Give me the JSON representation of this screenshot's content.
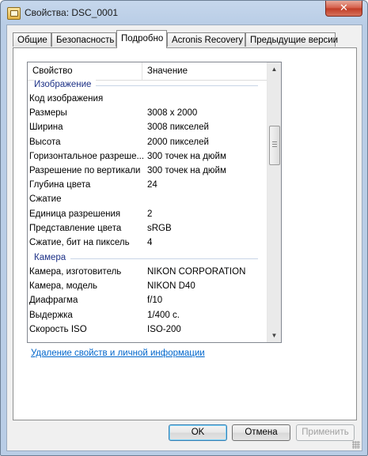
{
  "window": {
    "title": "Свойства: DSC_0001",
    "close_glyph": "✕"
  },
  "tabs": [
    {
      "label": "Общие"
    },
    {
      "label": "Безопасность"
    },
    {
      "label": "Подробно"
    },
    {
      "label": "Acronis Recovery"
    },
    {
      "label": "Предыдущие версии"
    }
  ],
  "list": {
    "columns": {
      "property": "Свойство",
      "value": "Значение"
    },
    "groups": [
      {
        "name": "Изображение",
        "rows": [
          {
            "k": "Код изображения",
            "v": ""
          },
          {
            "k": "Размеры",
            "v": "3008 x 2000"
          },
          {
            "k": "Ширина",
            "v": "3008 пикселей"
          },
          {
            "k": "Высота",
            "v": "2000 пикселей"
          },
          {
            "k": "Горизонтальное разреше...",
            "v": "300 точек на дюйм"
          },
          {
            "k": "Разрешение по вертикали",
            "v": "300 точек на дюйм"
          },
          {
            "k": "Глубина цвета",
            "v": "24"
          },
          {
            "k": "Сжатие",
            "v": ""
          },
          {
            "k": "Единица разрешения",
            "v": "2"
          },
          {
            "k": "Представление цвета",
            "v": "sRGB"
          },
          {
            "k": "Сжатие, бит на пиксель",
            "v": "4"
          }
        ]
      },
      {
        "name": "Камера",
        "rows": [
          {
            "k": "Камера, изготовитель",
            "v": "NIKON CORPORATION"
          },
          {
            "k": "Камера, модель",
            "v": "NIKON D40"
          },
          {
            "k": "Диафрагма",
            "v": "f/10"
          },
          {
            "k": "Выдержка",
            "v": "1/400 с."
          },
          {
            "k": "Скорость ISO",
            "v": "ISO-200"
          }
        ]
      }
    ]
  },
  "link": "Удаление свойств и личной информации",
  "buttons": {
    "ok": "OK",
    "cancel": "Отмена",
    "apply": "Применить"
  }
}
